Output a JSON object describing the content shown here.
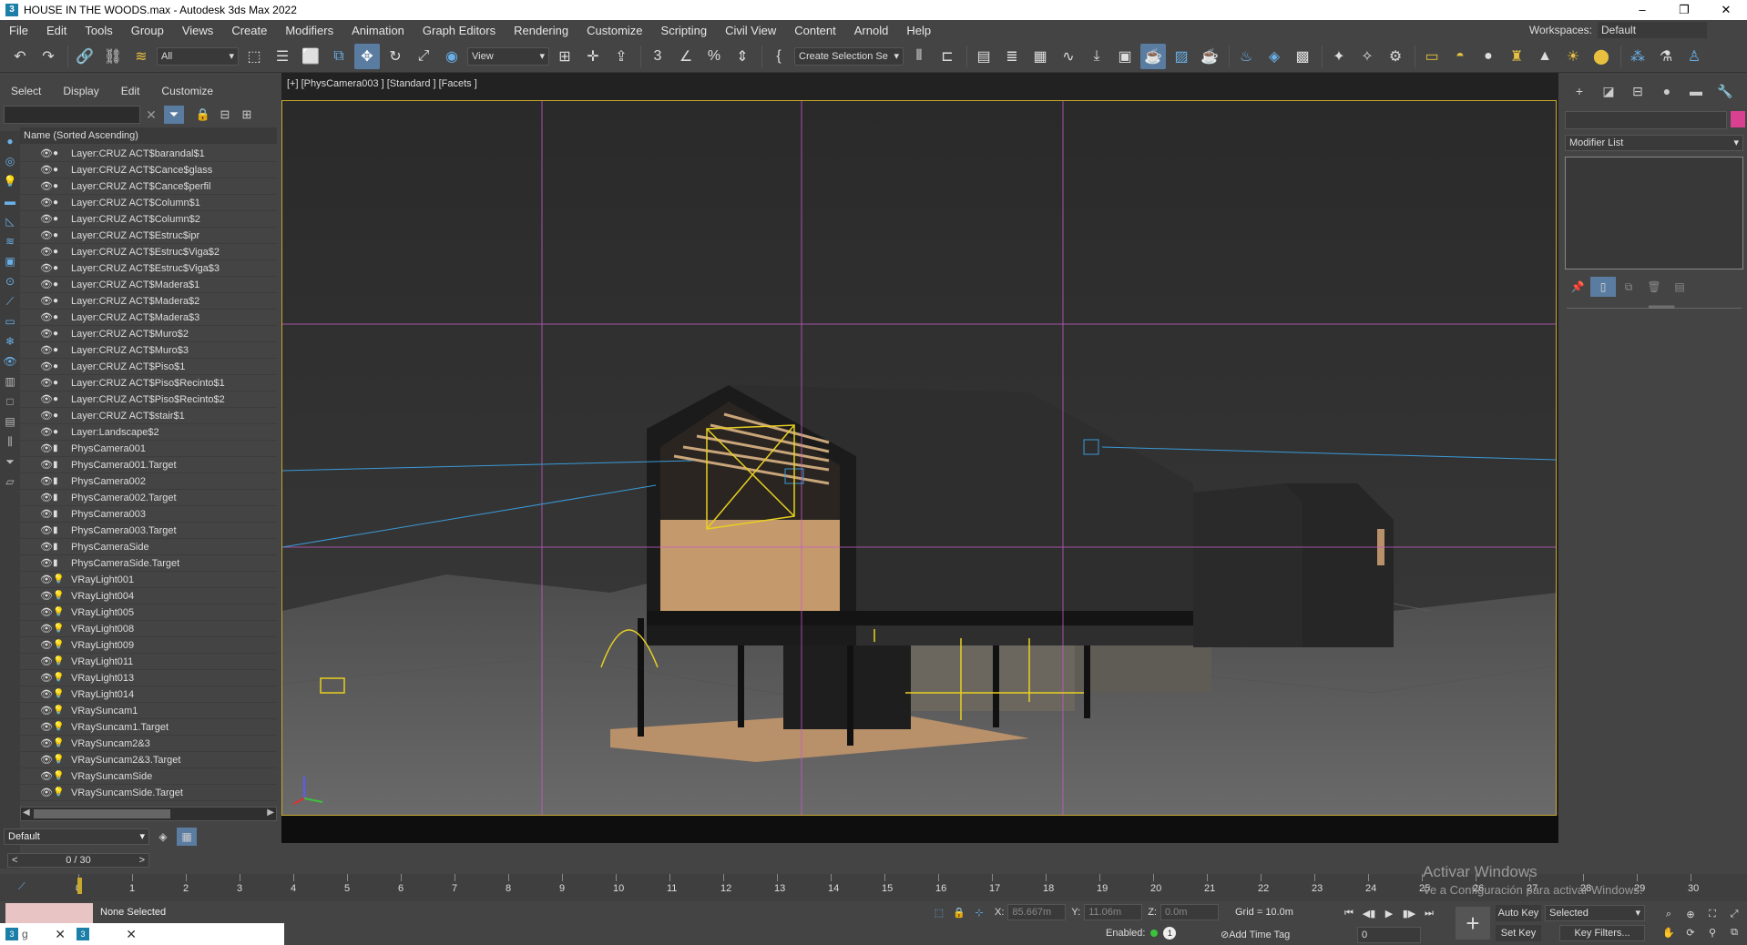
{
  "window": {
    "title": "HOUSE IN THE WOODS.max - Autodesk 3ds Max 2022",
    "controls": [
      "–",
      "❐",
      "✕"
    ]
  },
  "menu": {
    "items": [
      "File",
      "Edit",
      "Tools",
      "Group",
      "Views",
      "Create",
      "Modifiers",
      "Animation",
      "Graph Editors",
      "Rendering",
      "Customize",
      "Scripting",
      "Civil View",
      "Content",
      "Arnold",
      "Help"
    ],
    "workspace_label": "Workspaces:",
    "workspace_value": "Default"
  },
  "toolbar": {
    "filter_value": "All",
    "refcoord_value": "View",
    "selection_set": "Create Selection Se"
  },
  "scene_explorer": {
    "tabs": [
      "Select",
      "Display",
      "Edit",
      "Customize"
    ],
    "search_placeholder": "",
    "column_header": "Name (Sorted Ascending)",
    "items": [
      {
        "label": "Layer:CRUZ ACT$barandal$1",
        "icon": "sphere"
      },
      {
        "label": "Layer:CRUZ ACT$Cance$glass",
        "icon": "sphere"
      },
      {
        "label": "Layer:CRUZ ACT$Cance$perfil",
        "icon": "sphere"
      },
      {
        "label": "Layer:CRUZ ACT$Column$1",
        "icon": "sphere"
      },
      {
        "label": "Layer:CRUZ ACT$Column$2",
        "icon": "sphere"
      },
      {
        "label": "Layer:CRUZ ACT$Estruc$ipr",
        "icon": "sphere"
      },
      {
        "label": "Layer:CRUZ ACT$Estruc$Viga$2",
        "icon": "sphere"
      },
      {
        "label": "Layer:CRUZ ACT$Estruc$Viga$3",
        "icon": "sphere"
      },
      {
        "label": "Layer:CRUZ ACT$Madera$1",
        "icon": "sphere"
      },
      {
        "label": "Layer:CRUZ ACT$Madera$2",
        "icon": "sphere"
      },
      {
        "label": "Layer:CRUZ ACT$Madera$3",
        "icon": "sphere"
      },
      {
        "label": "Layer:CRUZ ACT$Muro$2",
        "icon": "sphere"
      },
      {
        "label": "Layer:CRUZ ACT$Muro$3",
        "icon": "sphere"
      },
      {
        "label": "Layer:CRUZ ACT$Piso$1",
        "icon": "sphere"
      },
      {
        "label": "Layer:CRUZ ACT$Piso$Recinto$1",
        "icon": "sphere"
      },
      {
        "label": "Layer:CRUZ ACT$Piso$Recinto$2",
        "icon": "sphere"
      },
      {
        "label": "Layer:CRUZ ACT$stair$1",
        "icon": "sphere"
      },
      {
        "label": "Layer:Landscape$2",
        "icon": "sphere"
      },
      {
        "label": "PhysCamera001",
        "icon": "camera"
      },
      {
        "label": "PhysCamera001.Target",
        "icon": "camera"
      },
      {
        "label": "PhysCamera002",
        "icon": "camera"
      },
      {
        "label": "PhysCamera002.Target",
        "icon": "camera"
      },
      {
        "label": "PhysCamera003",
        "icon": "camera"
      },
      {
        "label": "PhysCamera003.Target",
        "icon": "camera"
      },
      {
        "label": "PhysCameraSide",
        "icon": "camera"
      },
      {
        "label": "PhysCameraSide.Target",
        "icon": "camera"
      },
      {
        "label": "VRayLight001",
        "icon": "light"
      },
      {
        "label": "VRayLight004",
        "icon": "light"
      },
      {
        "label": "VRayLight005",
        "icon": "light"
      },
      {
        "label": "VRayLight008",
        "icon": "light"
      },
      {
        "label": "VRayLight009",
        "icon": "light"
      },
      {
        "label": "VRayLight011",
        "icon": "light"
      },
      {
        "label": "VRayLight013",
        "icon": "light"
      },
      {
        "label": "VRayLight014",
        "icon": "light"
      },
      {
        "label": "VRaySuncam1",
        "icon": "light"
      },
      {
        "label": "VRaySuncam1.Target",
        "icon": "light"
      },
      {
        "label": "VRaySuncam2&3",
        "icon": "light"
      },
      {
        "label": "VRaySuncam2&3.Target",
        "icon": "light"
      },
      {
        "label": "VRaySuncamSide",
        "icon": "light"
      },
      {
        "label": "VRaySuncamSide.Target",
        "icon": "light"
      }
    ],
    "layer_value": "Default"
  },
  "viewport": {
    "label": "[+] [PhysCamera003 ] [Standard ] [Facets ]"
  },
  "command_panel": {
    "modifier_list_label": "Modifier List",
    "object_color": "#d9408f"
  },
  "timeline": {
    "frame_display": "0 / 30",
    "ticks": [
      "0",
      "1",
      "2",
      "3",
      "4",
      "5",
      "6",
      "7",
      "8",
      "9",
      "10",
      "11",
      "12",
      "13",
      "14",
      "15",
      "16",
      "17",
      "18",
      "19",
      "20",
      "21",
      "22",
      "23",
      "24",
      "25",
      "26",
      "27",
      "28",
      "29",
      "30"
    ]
  },
  "status": {
    "selection": "None Selected",
    "x_label": "X:",
    "x_value": "85.667m",
    "y_label": "Y:",
    "y_value": "11.06m",
    "z_label": "Z:",
    "z_value": "0.0m",
    "grid": "Grid = 10.0m",
    "enabled_label": "Enabled:",
    "enabled_count": "1",
    "add_time_tag": "Add Time Tag",
    "current_frame": "0",
    "auto_key": "Auto Key",
    "set_key": "Set Key",
    "key_mode": "Selected",
    "key_filters": "Key Filters..."
  },
  "watermark": {
    "line1": "Activar Windows",
    "line2": "Ve a Configuración para activar Windows."
  },
  "taskbar": {
    "partial_text": "g"
  }
}
